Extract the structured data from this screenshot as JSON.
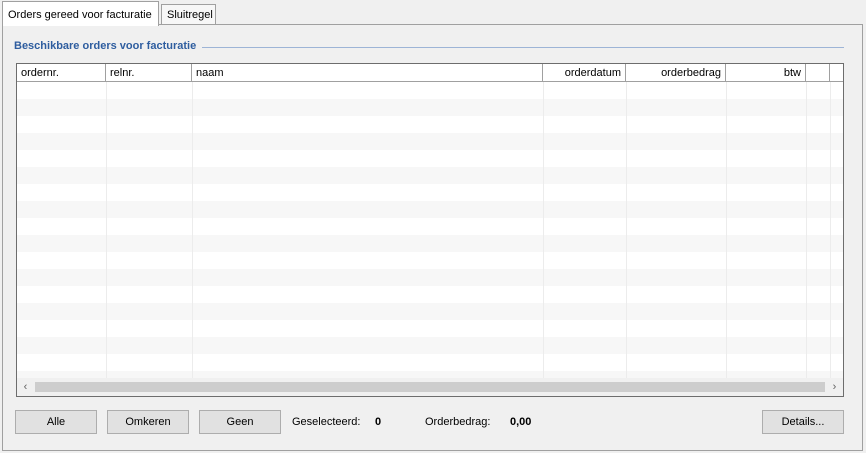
{
  "tabs": [
    {
      "label": "Orders gereed voor facturatie",
      "active": true
    },
    {
      "label": "Sluitregel",
      "active": false
    }
  ],
  "group": {
    "title": "Beschikbare orders voor facturatie"
  },
  "grid": {
    "columns": [
      "ordernr.",
      "relnr.",
      "naam",
      "orderdatum",
      "orderbedrag",
      "btw",
      "",
      ""
    ],
    "rows": []
  },
  "scrollbar": {
    "left_icon": "chevron-left-icon",
    "right_icon": "chevron-right-icon"
  },
  "footer": {
    "alle_label": "Alle",
    "omkeren_label": "Omkeren",
    "geen_label": "Geen",
    "geselecteerd_label": "Geselecteerd:",
    "geselecteerd_value": "0",
    "orderbedrag_label": "Orderbedrag:",
    "orderbedrag_value": "0,00",
    "details_label": "Details..."
  },
  "colors": {
    "group_title": "#2e5d9f",
    "group_line": "#9db4d6"
  }
}
